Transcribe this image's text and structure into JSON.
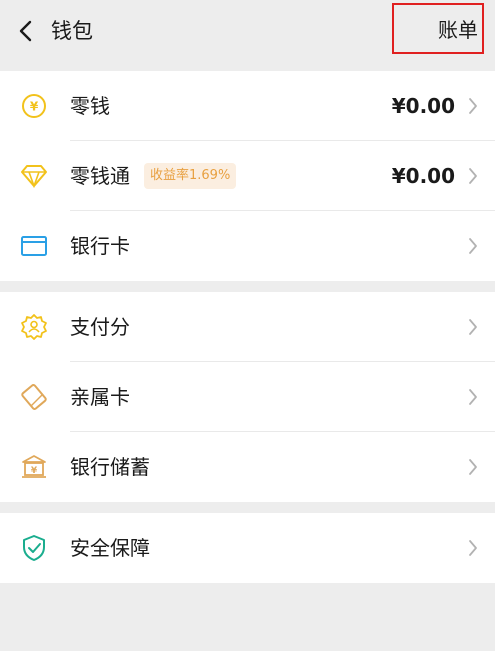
{
  "header": {
    "title": "钱包",
    "bill_label": "账单"
  },
  "group1": {
    "change": {
      "label": "零钱",
      "value": "¥0.00"
    },
    "change_plus": {
      "label": "零钱通",
      "badge": "收益率1.69%",
      "value": "¥0.00"
    },
    "bank_card": {
      "label": "银行卡"
    }
  },
  "group2": {
    "pay_score": {
      "label": "支付分"
    },
    "family_card": {
      "label": "亲属卡"
    },
    "bank_savings": {
      "label": "银行储蓄"
    }
  },
  "group3": {
    "security": {
      "label": "安全保障"
    }
  },
  "colors": {
    "yellow": "#f2c21b",
    "blue": "#2aa0e6",
    "orange": "#e0a85a",
    "green": "#1aad8e",
    "highlight_border": "#e02020"
  }
}
